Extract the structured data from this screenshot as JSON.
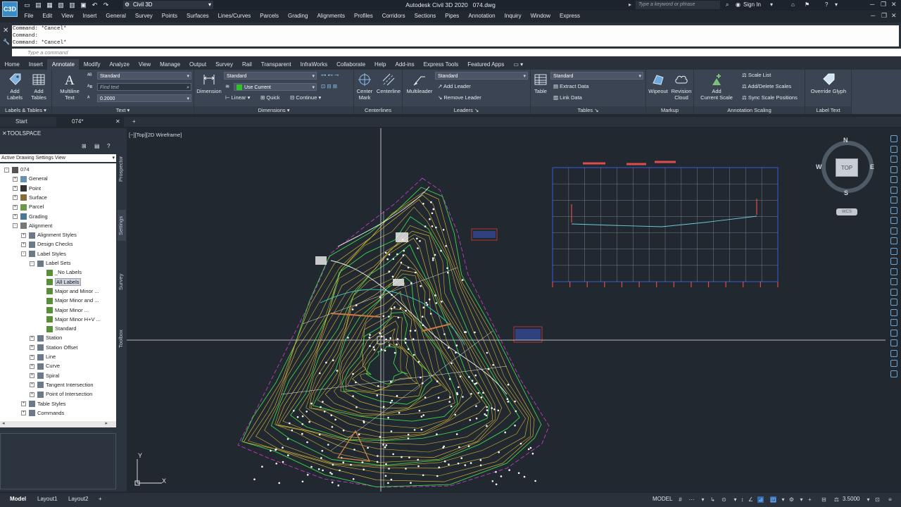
{
  "titlebar": {
    "app_logo": "C3D",
    "workspace": "Civil 3D",
    "title": "Autodesk Civil 3D 2020",
    "filename": "074.dwg",
    "search_placeholder": "Type a keyword or phrase",
    "signin": "Sign In"
  },
  "menubar": [
    "File",
    "Edit",
    "View",
    "Insert",
    "General",
    "Survey",
    "Points",
    "Surfaces",
    "Lines/Curves",
    "Parcels",
    "Grading",
    "Alignments",
    "Profiles",
    "Corridors",
    "Sections",
    "Pipes",
    "Annotation",
    "Inquiry",
    "Window",
    "Express"
  ],
  "command": {
    "history": [
      "Command: *Cancel*",
      "Command:",
      "Command: *Cancel*"
    ],
    "placeholder": "Type a command"
  },
  "ribbon_tabs": {
    "items": [
      "Home",
      "Insert",
      "Annotate",
      "Modify",
      "Analyze",
      "View",
      "Manage",
      "Output",
      "Survey",
      "Rail",
      "Transparent",
      "InfraWorks",
      "Collaborate",
      "Help",
      "Add-ins",
      "Express Tools",
      "Featured Apps"
    ],
    "active": "Annotate"
  },
  "ribbon": {
    "labels_tables": {
      "add_labels": "Add\nLabels",
      "add_tables": "Add\nTables",
      "footer": "Labels & Tables"
    },
    "text": {
      "multiline": "Multiline\nText",
      "style": "Standard",
      "find": "Find text",
      "height": "0.2000",
      "footer": "Text"
    },
    "dimensions": {
      "dimension": "Dimension",
      "style": "Standard",
      "layer": "Use Current",
      "linear": "Linear",
      "quick": "Quick",
      "continue": "Continue",
      "footer": "Dimensions"
    },
    "centerlines": {
      "center_mark": "Center\nMark",
      "centerline": "Centerline",
      "footer": "Centerlines"
    },
    "leaders": {
      "multileader": "Multileader",
      "style": "Standard",
      "add": "Add Leader",
      "remove": "Remove Leader",
      "footer": "Leaders"
    },
    "tables": {
      "table": "Table",
      "style": "Standard",
      "extract": "Extract Data",
      "link": "Link Data",
      "footer": "Tables"
    },
    "markup": {
      "wipeout": "Wipeout",
      "revision": "Revision\nCloud",
      "footer": "Markup"
    },
    "scaling": {
      "add_scale": "Add\nCurrent Scale",
      "scale_list": "Scale List",
      "add_delete": "Add/Delete Scales",
      "sync": "Sync Scale Positions",
      "footer": "Annotation Scaling"
    },
    "label_text": {
      "override": "Override Glyph",
      "footer": "Label Text"
    }
  },
  "filetabs": [
    "Start",
    "074*"
  ],
  "toolspace": {
    "header": "TOOLSPACE",
    "view": "Active Drawing Settings View",
    "side_tabs": [
      "Prospector",
      "Settings",
      "Survey",
      "Toolbox"
    ],
    "tree": [
      "074",
      "General",
      "Point",
      "Surface",
      "Parcel",
      "Grading",
      "Alignment",
      "Alignment Styles",
      "Design Checks",
      "Label Styles",
      "Label Sets",
      "_No Labels",
      "All Labels",
      "Major and Minor ...",
      "Major Minor and ...",
      "Major Minor ...",
      "Major Minor H+V ...",
      "Standard",
      "Station",
      "Station Offset",
      "Line",
      "Curve",
      "Spiral",
      "Tangent Intersection",
      "Point of Intersection",
      "Table Styles",
      "Commands"
    ]
  },
  "viewport": {
    "label": "[−][Top][2D Wireframe]",
    "compass": {
      "n": "N",
      "s": "S",
      "e": "E",
      "w": "W",
      "top": "TOP"
    },
    "wcs": "WCS",
    "ucs_y": "Y",
    "ucs_x": "X"
  },
  "statusbar": {
    "tabs": [
      "Model",
      "Layout1",
      "Layout2"
    ],
    "mode": "MODEL",
    "scale": "3.5000"
  }
}
